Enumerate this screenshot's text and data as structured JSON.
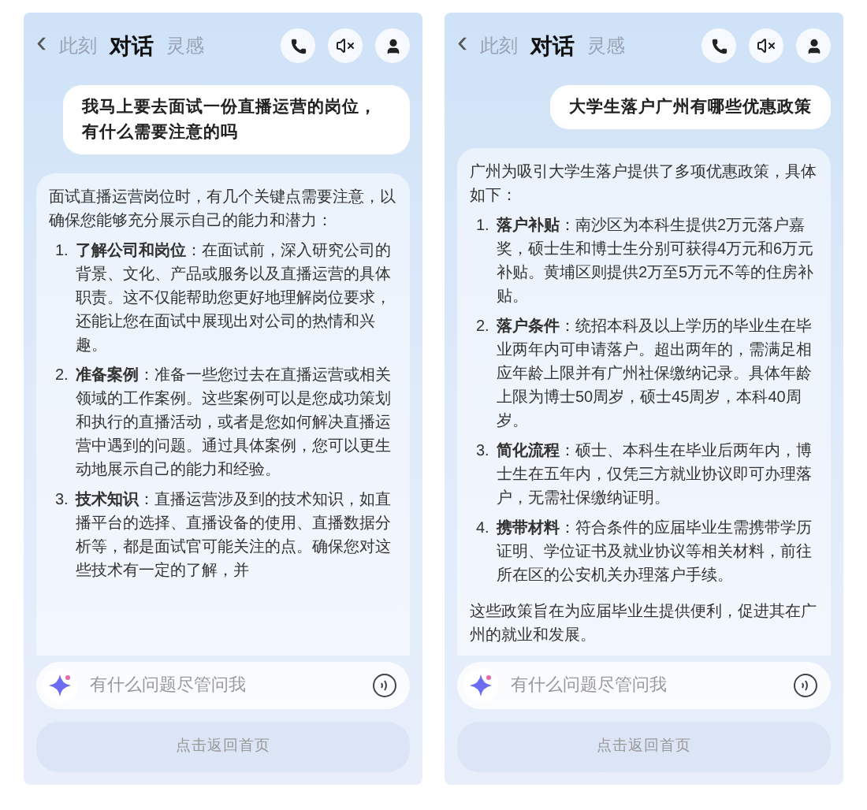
{
  "screens": [
    {
      "back": "‹",
      "tabs": [
        {
          "label": "此刻",
          "selected": false
        },
        {
          "label": "对话",
          "selected": true
        },
        {
          "label": "灵感",
          "selected": false
        }
      ],
      "question": "我马上要去面试一份直播运营的岗位，有什么需要注意的吗",
      "answer": {
        "intro": "面试直播运营岗位时，有几个关键点需要注意，以确保您能够充分展示自己的能力和潜力：",
        "items": [
          {
            "number": "1.",
            "title": "了解公司和岗位",
            "text": "：在面试前，深入研究公司的背景、文化、产品或服务以及直播运营的具体职责。这不仅能帮助您更好地理解岗位要求，还能让您在面试中展现出对公司的热情和兴趣。"
          },
          {
            "number": "2.",
            "title": "准备案例",
            "text": "：准备一些您过去在直播运营或相关领域的工作案例。这些案例可以是您成功策划和执行的直播活动，或者是您如何解决直播运营中遇到的问题。通过具体案例，您可以更生动地展示自己的能力和经验。"
          },
          {
            "number": "3.",
            "title": "技术知识",
            "text": "：直播运营涉及到的技术知识，如直播平台的选择、直播设备的使用、直播数据分析等，都是面试官可能关注的点。确保您对这些技术有一定的了解，并"
          }
        ]
      },
      "input": {
        "placeholder": "有什么问题尽管问我"
      },
      "footer": "点击返回首页"
    },
    {
      "back": "‹",
      "tabs": [
        {
          "label": "此刻",
          "selected": false
        },
        {
          "label": "对话",
          "selected": true
        },
        {
          "label": "灵感",
          "selected": false
        }
      ],
      "question": "大学生落户广州有哪些优惠政策",
      "answer": {
        "intro": "广州为吸引大学生落户提供了多项优惠政策，具体如下：",
        "items": [
          {
            "number": "1.",
            "title": "落户补贴",
            "text": "：南沙区为本科生提供2万元落户嘉奖，硕士生和博士生分别可获得4万元和6万元补贴。黄埔区则提供2万至5万元不等的住房补贴。"
          },
          {
            "number": "2.",
            "title": "落户条件",
            "text": "：统招本科及以上学历的毕业生在毕业两年内可申请落户。超出两年的，需满足相应年龄上限并有广州社保缴纳记录。具体年龄上限为博士50周岁，硕士45周岁，本科40周岁。"
          },
          {
            "number": "3.",
            "title": "简化流程",
            "text": "：硕士、本科生在毕业后两年内，博士生在五年内，仅凭三方就业协议即可办理落户，无需社保缴纳证明。"
          },
          {
            "number": "4.",
            "title": "携带材料",
            "text": "：符合条件的应届毕业生需携带学历证明、学位证书及就业协议等相关材料，前往所在区的公安机关办理落户手续。"
          }
        ],
        "outro": "这些政策旨在为应届毕业生提供便利，促进其在广州的就业和发展。"
      },
      "input": {
        "placeholder": "有什么问题尽管问我"
      },
      "footer": "点击返回首页"
    }
  ]
}
